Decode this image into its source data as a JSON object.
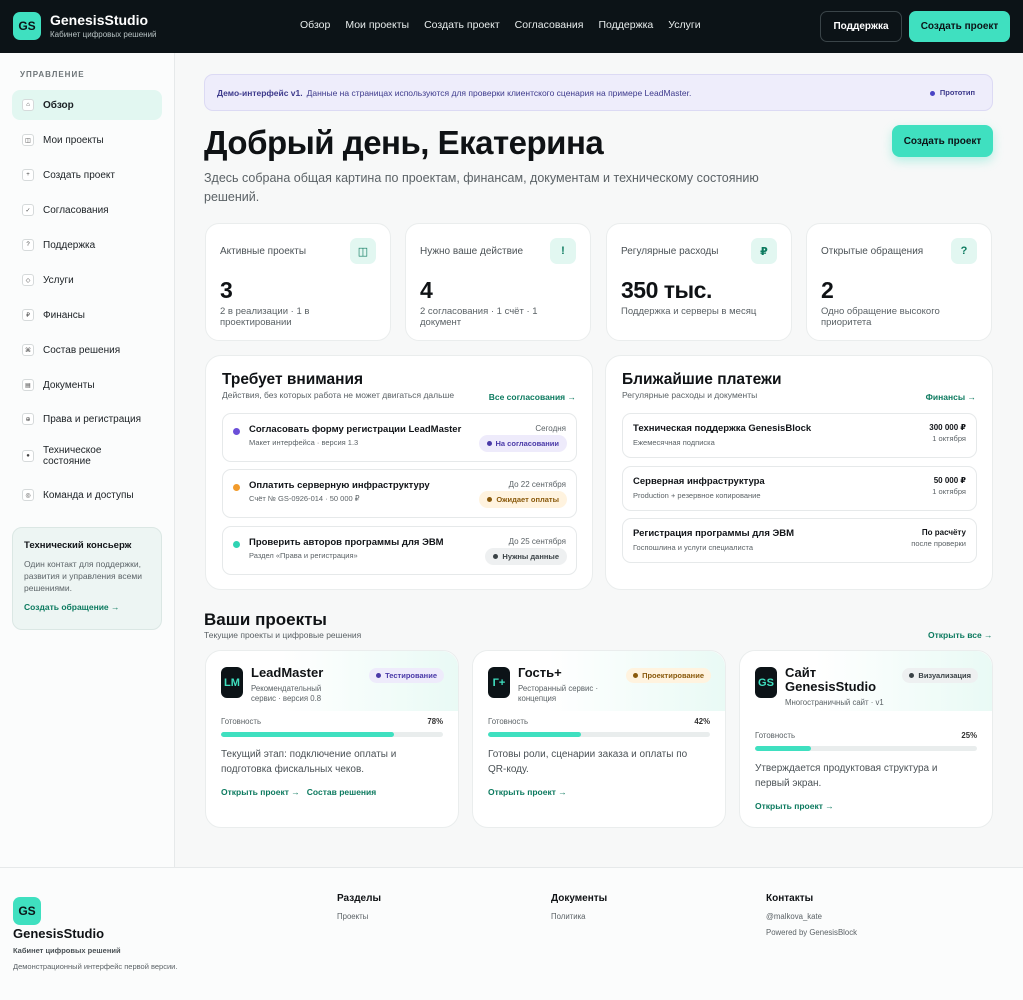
{
  "header": {
    "logo_text": "GS",
    "brand_name": "GenesisStudio",
    "brand_sub": "Кабинет цифровых решений",
    "nav": [
      "Обзор",
      "Мои проекты",
      "Создать проект",
      "Согласования",
      "Поддержка",
      "Услуги"
    ],
    "support_button": "Поддержка",
    "create_button": "Создать проект"
  },
  "sidebar": {
    "heading": "УПРАВЛЕНИЕ",
    "items": [
      {
        "label": "Обзор",
        "icon": "⌂"
      },
      {
        "label": "Мои проекты",
        "icon": "◫"
      },
      {
        "label": "Создать проект",
        "icon": "+"
      },
      {
        "label": "Согласования",
        "icon": "✓"
      },
      {
        "label": "Поддержка",
        "icon": "?"
      },
      {
        "label": "Услуги",
        "icon": "◇"
      },
      {
        "label": "Финансы",
        "icon": "₽"
      },
      {
        "label": "Состав решения",
        "icon": "⌘"
      },
      {
        "label": "Документы",
        "icon": "▤"
      },
      {
        "label": "Права и регистрация",
        "icon": "⊕"
      },
      {
        "label": "Техническое состояние",
        "icon": "●"
      },
      {
        "label": "Команда и доступы",
        "icon": "◎"
      }
    ],
    "concierge": {
      "title": "Технический консьерж",
      "text": "Один контакт для поддержки, развития и управления всеми решениями.",
      "link": "Создать обращение →"
    }
  },
  "banner": {
    "strong": "Демо-интерфейс v1.",
    "text": "Данные на страницах используются для проверки клиентского сценария на примере LeadMaster.",
    "tag": "Прототип"
  },
  "greeting": {
    "title": "Добрый день, Екатерина",
    "subtitle": "Здесь собрана общая картина по проектам, финансам, документам и техническому состоянию решений.",
    "button": "Создать проект"
  },
  "stats": [
    {
      "label": "Активные проекты",
      "icon": "◫",
      "value": "3",
      "desc": "2 в реализации · 1 в проектировании"
    },
    {
      "label": "Нужно ваше действие",
      "icon": "!",
      "value": "4",
      "desc": "2 согласования · 1 счёт · 1 документ"
    },
    {
      "label": "Регулярные расходы",
      "icon": "₽",
      "value": "350 тыс.",
      "desc": "Поддержка и серверы в месяц"
    },
    {
      "label": "Открытые обращения",
      "icon": "?",
      "value": "2",
      "desc": "Одно обращение высокого приоритета"
    }
  ],
  "attention": {
    "title": "Требует внимания",
    "subtitle": "Действия, без которых работа не может двигаться дальше",
    "link": "Все согласования →",
    "rows": [
      {
        "title": "Согласовать форму регистрации LeadMaster",
        "sub": "Макет интерфейса · версия 1.3",
        "date": "Сегодня",
        "badge": "На согласовании",
        "dot": "#6b4fd8",
        "badge_bg": "#eeebfb",
        "badge_fg": "#4a3aa8"
      },
      {
        "title": "Оплатить серверную инфраструктуру",
        "sub": "Счёт № GS-0926-014 · 50 000 ₽",
        "date": "До 22 сентября",
        "badge": "Ожидает оплаты",
        "dot": "#f29b2b",
        "badge_bg": "#fff3df",
        "badge_fg": "#8a5a0c"
      },
      {
        "title": "Проверить авторов программы для ЭВМ",
        "sub": "Раздел «Права и регистрация»",
        "date": "До 25 сентября",
        "badge": "Нужны данные",
        "dot": "#2fd3b3",
        "badge_bg": "#eef0f1",
        "badge_fg": "#3a4246"
      }
    ]
  },
  "payments": {
    "title": "Ближайшие платежи",
    "subtitle": "Регулярные расходы и документы",
    "link": "Финансы →",
    "rows": [
      {
        "title": "Техническая поддержка GenesisBlock",
        "sub": "Ежемесячная подписка",
        "amount": "300 000 ₽",
        "when": "1 октября"
      },
      {
        "title": "Серверная инфраструктура",
        "sub": "Production + резервное копирование",
        "amount": "50 000 ₽",
        "when": "1 октября"
      },
      {
        "title": "Регистрация программы для ЭВМ",
        "sub": "Госпошлина и услуги специалиста",
        "amount": "По расчёту",
        "when": "после проверки"
      }
    ]
  },
  "projects": {
    "title": "Ваши проекты",
    "subtitle": "Текущие проекты и цифровые решения",
    "open_all": "Открыть все →",
    "ready_label": "Готовность",
    "items": [
      {
        "logo": "LM",
        "name": "LeadMaster",
        "desc": "Рекомендательный сервис · версия 0.8",
        "badge": "Тестирование",
        "badge_bg": "#eeebfb",
        "badge_fg": "#4a3aa8",
        "progress": 78,
        "progress_label": "78%",
        "note": "Текущий этап: подключение оплаты и подготовка фискальных чеков.",
        "links": [
          "Открыть проект →",
          "Состав решения"
        ]
      },
      {
        "logo": "Г+",
        "name": "Гость+",
        "desc": "Ресторанный сервис · концепция",
        "badge": "Проектирование",
        "badge_bg": "#fff3df",
        "badge_fg": "#8a5a0c",
        "progress": 42,
        "progress_label": "42%",
        "note": "Готовы роли, сценарии заказа и оплаты по QR-коду.",
        "links": [
          "Открыть проект →"
        ]
      },
      {
        "logo": "GS",
        "name": "Сайт GenesisStudio",
        "desc": "Многостраничный сайт · v1",
        "badge": "Визуализация",
        "badge_bg": "#eef0f1",
        "badge_fg": "#3a4246",
        "progress": 25,
        "progress_label": "25%",
        "note": "Утверждается продуктовая структура и первый экран.",
        "links": [
          "Открыть проект →"
        ]
      }
    ]
  },
  "footer": {
    "logo_text": "GS",
    "name": "GenesisStudio",
    "sub": "Кабинет цифровых решений",
    "desc": "Демонстрационный интерфейс первой версии.",
    "col1_title": "Разделы",
    "col1_link": "Проекты",
    "col2_title": "Документы",
    "col2_link": "Политика",
    "col3_title": "Контакты",
    "col3_link1": "@malkova_kate",
    "col3_link2": "Powered by GenesisBlock"
  }
}
